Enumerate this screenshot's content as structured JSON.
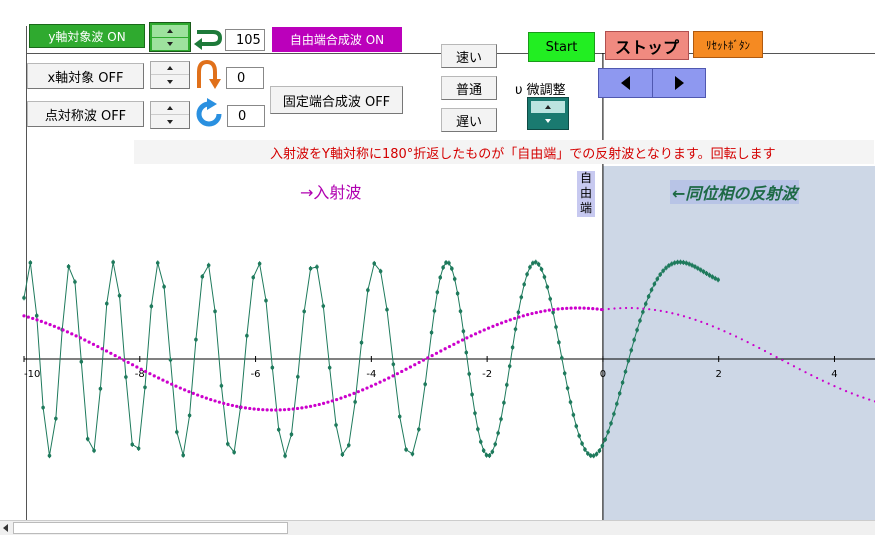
{
  "controls": {
    "y_wave_btn": "y軸対象波 ON",
    "x_axis_btn": "x軸対象 OFF",
    "point_sym_btn": "点対称波 OFF",
    "free_comp_btn": "自由端合成波 ON",
    "fixed_comp_btn": "固定端合成波 OFF",
    "speed_fast": "速い",
    "speed_normal": "普通",
    "speed_slow": "遅い",
    "fine_tune_label": "υ 微調整",
    "start_btn": "Start",
    "stop_btn": "ストップ",
    "reset_btn": "ﾘｾｯﾄﾎﾞﾀﾝ",
    "value_1": "105",
    "value_2": "0",
    "value_3": "0"
  },
  "notice": "入射波をY軸対称に180°折返したものが「自由端」での反射波となります。回転します",
  "labels": {
    "incident": "→入射波",
    "free_end": [
      "自",
      "由",
      "端"
    ],
    "reflected": "←同位相の反射波"
  },
  "colors": {
    "incident": "#cc00cc",
    "composite": "#1e7a5c",
    "reflection_region": "#cdd7e6",
    "notice_text": "#d40000",
    "label_purple": "#b000b0",
    "label_green": "#1e6a46",
    "green_btn": "#2faa2f",
    "start_btn": "#22ee22",
    "stop_btn": "#f08a80",
    "reset_btn": "#f58a22",
    "magenta_btn": "#bb00bb"
  },
  "chart_data": {
    "type": "line",
    "xlim": [
      -10,
      4.7
    ],
    "ylim": [
      -1.7,
      1.7
    ],
    "x_ticks": [
      -10,
      -8,
      -6,
      -4,
      -2,
      0,
      2,
      4
    ],
    "x_tick_labels": [
      "-10",
      "-8",
      "-6",
      "-4",
      "-2",
      "0",
      "2",
      "4"
    ],
    "free_end_x": 0,
    "series": [
      {
        "role": "incident",
        "style": "solid-dots",
        "amplitude": 1,
        "wavelength": 10.5,
        "phase_deg": 105,
        "x_range": [
          -10,
          0
        ]
      },
      {
        "role": "reflected",
        "style": "dotted",
        "amplitude": 1,
        "wavelength": 10.5,
        "phase_deg": 105,
        "x_range": [
          0,
          4.7
        ]
      },
      {
        "role": "composite",
        "style": "dots-with-stems",
        "amplitude": 1.9,
        "approx_wavelength_at_origin": 1.4,
        "x_range": [
          -10,
          2
        ]
      }
    ]
  }
}
